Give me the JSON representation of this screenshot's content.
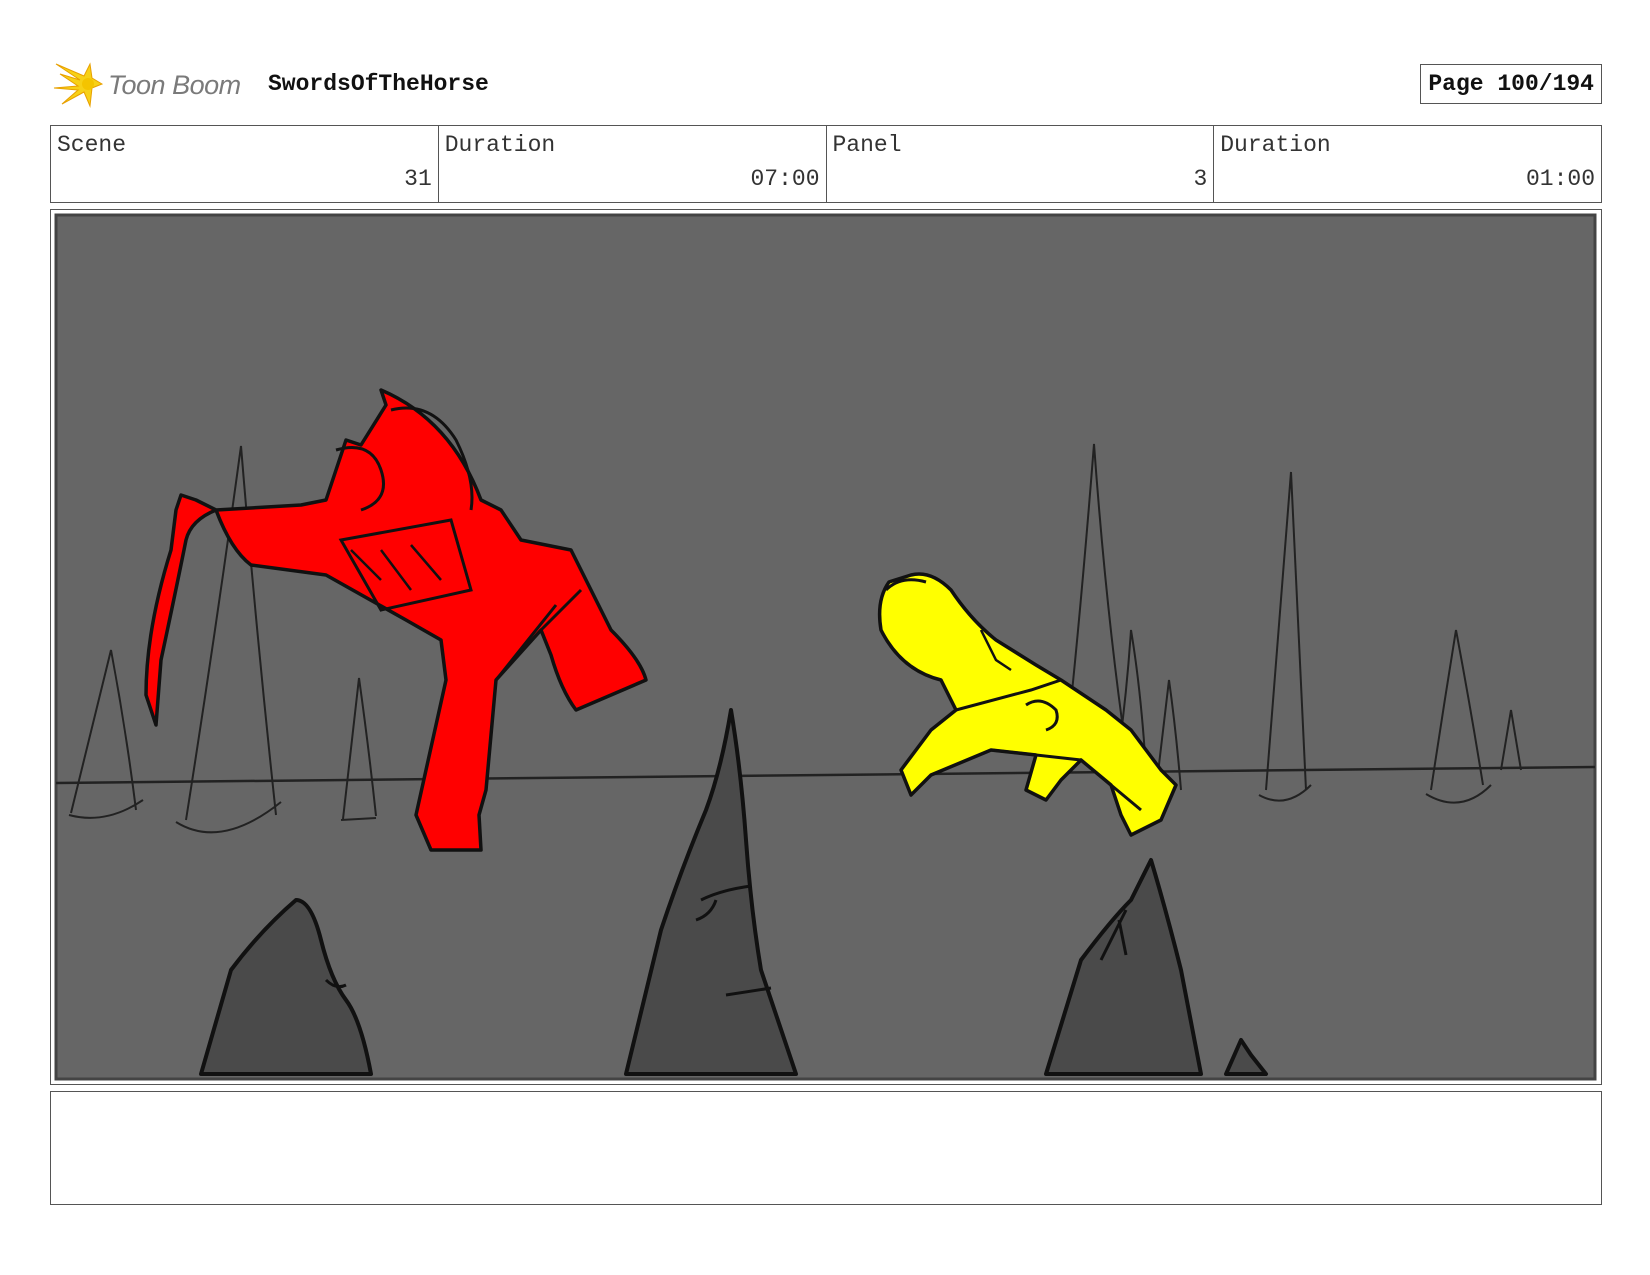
{
  "header": {
    "logo_text": "Toon Boom",
    "project_title": "SwordsOfTheHorse",
    "page_label": "Page 100/194"
  },
  "info": {
    "scene_label": "Scene",
    "scene_value": "31",
    "scene_duration_label": "Duration",
    "scene_duration_value": "07:00",
    "panel_label": "Panel",
    "panel_value": "3",
    "panel_duration_label": "Duration",
    "panel_duration_value": "01:00"
  },
  "colors": {
    "panel_background": "#666666",
    "red_figure": "#ff0000",
    "yellow_figure": "#ffff00",
    "rock": "#4a4a4a",
    "logo_yellow": "#f7d117"
  },
  "notes": {
    "text": ""
  }
}
